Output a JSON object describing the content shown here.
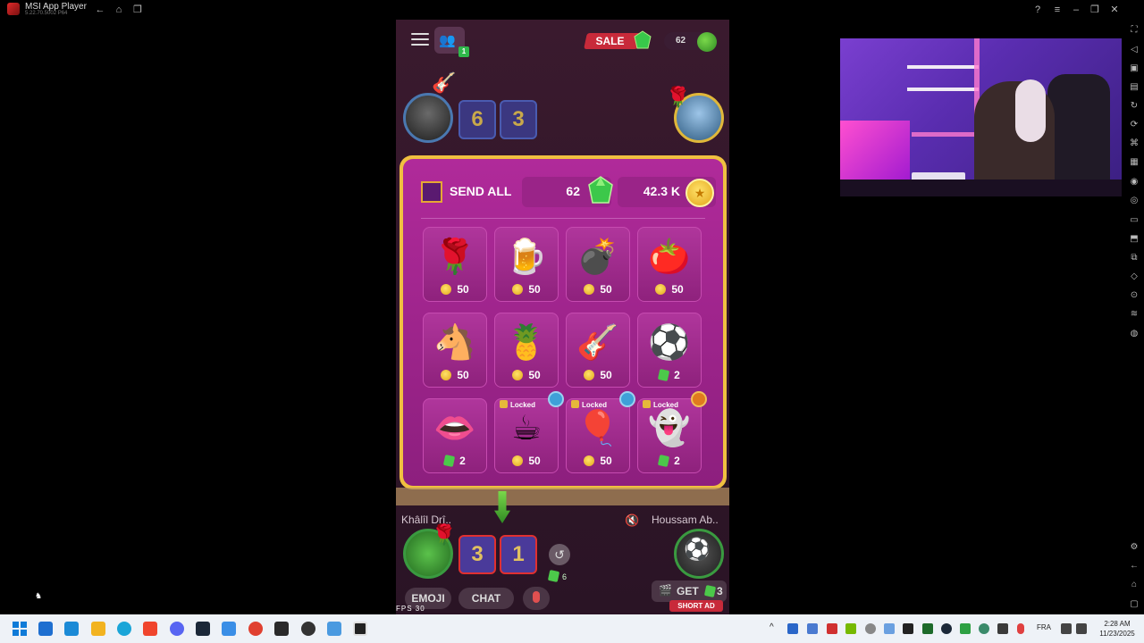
{
  "emulator": {
    "app_name": "MSI App Player",
    "version": "5.22.70.5002 P64"
  },
  "game": {
    "sale_label": "SALE",
    "top_gems": "62",
    "friends_badge": "1",
    "scores_top": [
      "6",
      "3"
    ],
    "scores_bottom": [
      "3",
      "1"
    ],
    "player_left_name": "Khâlîl Drî..",
    "player_right_name": "Houssam Ab..",
    "gem_small_count": "6",
    "emoji_button": "EMOJI",
    "chat_button": "CHAT",
    "get_label": "GET",
    "get_count": "3",
    "short_ad_label": "SHORT AD",
    "fps_label": "FPS  30"
  },
  "gift_panel": {
    "send_all_label": "SEND ALL",
    "gems_balance": "62",
    "coins_balance": "42.3 K",
    "locked_label": "Locked",
    "gifts": [
      {
        "name": "Rose",
        "emoji": "🌹",
        "price": "50",
        "currency": "coin",
        "locked": false
      },
      {
        "name": "Beer",
        "emoji": "🍺",
        "price": "50",
        "currency": "coin",
        "locked": false
      },
      {
        "name": "Bomb",
        "emoji": "💣",
        "price": "50",
        "currency": "coin",
        "locked": false
      },
      {
        "name": "Tomato",
        "emoji": "🍅",
        "price": "50",
        "currency": "coin",
        "locked": false
      },
      {
        "name": "Donkey",
        "emoji": "🐴",
        "price": "50",
        "currency": "coin",
        "locked": false
      },
      {
        "name": "Pineapple",
        "emoji": "🍍",
        "price": "50",
        "currency": "coin",
        "locked": false
      },
      {
        "name": "Guitar",
        "emoji": "🎸",
        "price": "50",
        "currency": "coin",
        "locked": false
      },
      {
        "name": "Soccer Ball",
        "emoji": "⚽",
        "price": "2",
        "currency": "gem",
        "locked": false
      },
      {
        "name": "Lips",
        "emoji": "👄",
        "price": "2",
        "currency": "gem",
        "locked": false
      },
      {
        "name": "Coffee",
        "emoji": "☕",
        "price": "50",
        "currency": "coin",
        "locked": true,
        "tier": "blue"
      },
      {
        "name": "Balloons",
        "emoji": "🎈",
        "price": "50",
        "currency": "coin",
        "locked": true,
        "tier": "blue"
      },
      {
        "name": "Ghost",
        "emoji": "👻",
        "price": "2",
        "currency": "gem",
        "locked": true,
        "tier": "gold"
      }
    ]
  },
  "taskbar": {
    "lang": "FRA",
    "time": "2:28 AM",
    "date": "11/23/2025"
  }
}
